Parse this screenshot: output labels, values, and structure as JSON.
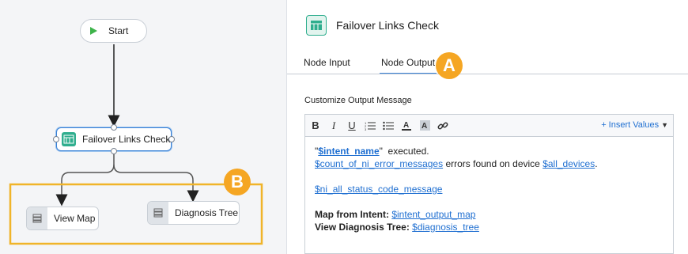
{
  "canvas": {
    "start_label": "Start",
    "main_node_label": "Failover Links Check",
    "view_map_label": "View Map",
    "diagnosis_tree_label": "Diagnosis Tree",
    "callout_b": "B"
  },
  "panel": {
    "title": "Failover Links Check",
    "tabs": [
      "Node Input",
      "Node Output"
    ],
    "active_tab": "Node Output",
    "callout_a": "A",
    "section_label": "Customize Output Message",
    "insert_values_label": "+ Insert Values",
    "toolbar_icons": [
      "bold-icon",
      "italic-icon",
      "underline-icon",
      "numbered-list-icon",
      "bulleted-list-icon",
      "font-color-icon",
      "background-color-icon",
      "link-icon"
    ],
    "message": {
      "line1_open_quote": "\"",
      "line1_var": "$intent_name",
      "line1_close": "\"  executed.",
      "line2_var1": "$count_of_ni_error_messages",
      "line2_mid": " errors found on device ",
      "line2_var2": "$all_devices",
      "line2_end": ".",
      "line3_var": "$ni_all_status_code_message",
      "line4_label": "Map from Intent:",
      "line4_var": "$intent_output_map",
      "line5_label": "View Diagnosis Tree:",
      "line5_var": "$diagnosis_tree"
    }
  },
  "colors": {
    "accent": "#3b82d6",
    "callout": "#f5a623",
    "link": "#1f6fd1",
    "start_play": "#3db34a"
  }
}
